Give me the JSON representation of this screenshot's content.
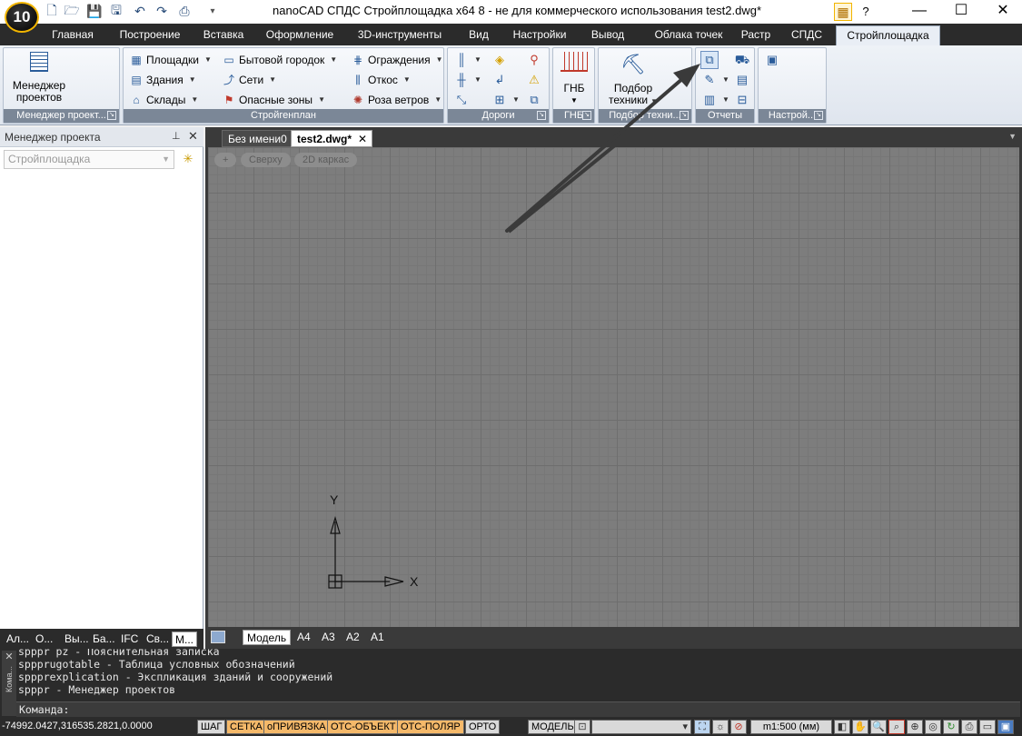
{
  "window": {
    "title": "nanoCAD СПДС Стройплощадка x64 8 - не для коммерческого использования test2.dwg*",
    "logo_text": "10",
    "controls": {
      "minimize": "—",
      "maximize": "☐",
      "close": "✕"
    },
    "help": "?"
  },
  "quick_access": [
    "new-icon",
    "open-icon",
    "save-icon",
    "save-as-icon",
    "undo-icon",
    "redo-icon",
    "print-icon"
  ],
  "ribbon_tabs": [
    {
      "label": "Главная",
      "active": false
    },
    {
      "label": "Построение",
      "active": false
    },
    {
      "label": "Вставка",
      "active": false
    },
    {
      "label": "Оформление",
      "active": false
    },
    {
      "label": "3D-инструменты",
      "active": false
    },
    {
      "label": "Вид",
      "active": false
    },
    {
      "label": "Настройки",
      "active": false
    },
    {
      "label": "Вывод",
      "active": false
    },
    {
      "label": "Облака точек",
      "active": false
    },
    {
      "label": "Растр",
      "active": false
    },
    {
      "label": "СПДС",
      "active": false
    },
    {
      "label": "Стройплощадка",
      "active": true
    }
  ],
  "ribbon": {
    "project_manager": {
      "button_line1": "Менеджер",
      "button_line2": "проектов",
      "group_label": "Менеджер проект..."
    },
    "stroygenplan": {
      "group_label": "Стройгенплан",
      "col1": [
        "Площадки",
        "Здания",
        "Склады"
      ],
      "col2": [
        "Бытовой городок",
        "Сети",
        "Опасные зоны"
      ],
      "col3": [
        "Ограждения",
        "Откос",
        "Роза ветров"
      ]
    },
    "roads": {
      "group_label": "Дороги"
    },
    "gnb": {
      "button": "ГНБ",
      "group_label": "ГНБ"
    },
    "equipment": {
      "button_line1": "Подбор",
      "button_line2": "техники",
      "group_label": "Подбор техни..."
    },
    "reports": {
      "group_label": "Отчеты"
    },
    "settings": {
      "group_label": "Настрой..."
    }
  },
  "left_panel": {
    "title": "Менеджер проекта",
    "pin": "ꟷ",
    "close": "✕",
    "selector_value": "Стройплощадка",
    "bottom_tabs": [
      {
        "label": "Ал...",
        "active": false
      },
      {
        "label": "О...",
        "active": false
      },
      {
        "label": "Вы...",
        "active": false
      },
      {
        "label": "Ба...",
        "active": false
      },
      {
        "label": "IFC",
        "active": false
      },
      {
        "label": "Св...",
        "active": false
      },
      {
        "label": "М...",
        "active": true
      }
    ]
  },
  "documents": {
    "tabs": [
      {
        "label": "Без имени0",
        "active": false
      },
      {
        "label": "test2.dwg*",
        "active": true
      }
    ],
    "viewport_controls": [
      "+",
      "Сверху",
      "2D каркас"
    ],
    "ucs": {
      "x_label": "X",
      "y_label": "Y"
    },
    "layout_tabs": [
      {
        "label": "Модель",
        "active": true
      },
      {
        "label": "A4",
        "active": false
      },
      {
        "label": "A3",
        "active": false
      },
      {
        "label": "A2",
        "active": false
      },
      {
        "label": "A1",
        "active": false
      }
    ]
  },
  "command_line": {
    "side_label": "Кома...",
    "history": [
      "spppr pz - Пояснительная записка",
      "sppprugotable - Таблица условных обозначений",
      "sppprexplication - Экспликация зданий и сооружений",
      "spppr - Менеджер проектов"
    ],
    "prompt": "Команда:"
  },
  "status_bar": {
    "coords": "-74992.0427,316535.2821,0.0000",
    "toggles": [
      {
        "label": "ШАГ",
        "on": false
      },
      {
        "label": "СЕТКА",
        "on": true
      },
      {
        "label": "оПРИВЯЗКА",
        "on": true
      },
      {
        "label": "ОТС-ОБЪЕКТ",
        "on": true
      },
      {
        "label": "ОТС-ПОЛЯР",
        "on": true
      },
      {
        "label": "ОРТО",
        "on": false
      }
    ],
    "space": "МОДЕЛЬ",
    "scale": "m1:500 (мм)"
  },
  "colors": {
    "accent": "#f5b96a",
    "dark": "#2b2b2b",
    "canvas": "#7d7d7d",
    "arrow": "#3a3a3a"
  }
}
